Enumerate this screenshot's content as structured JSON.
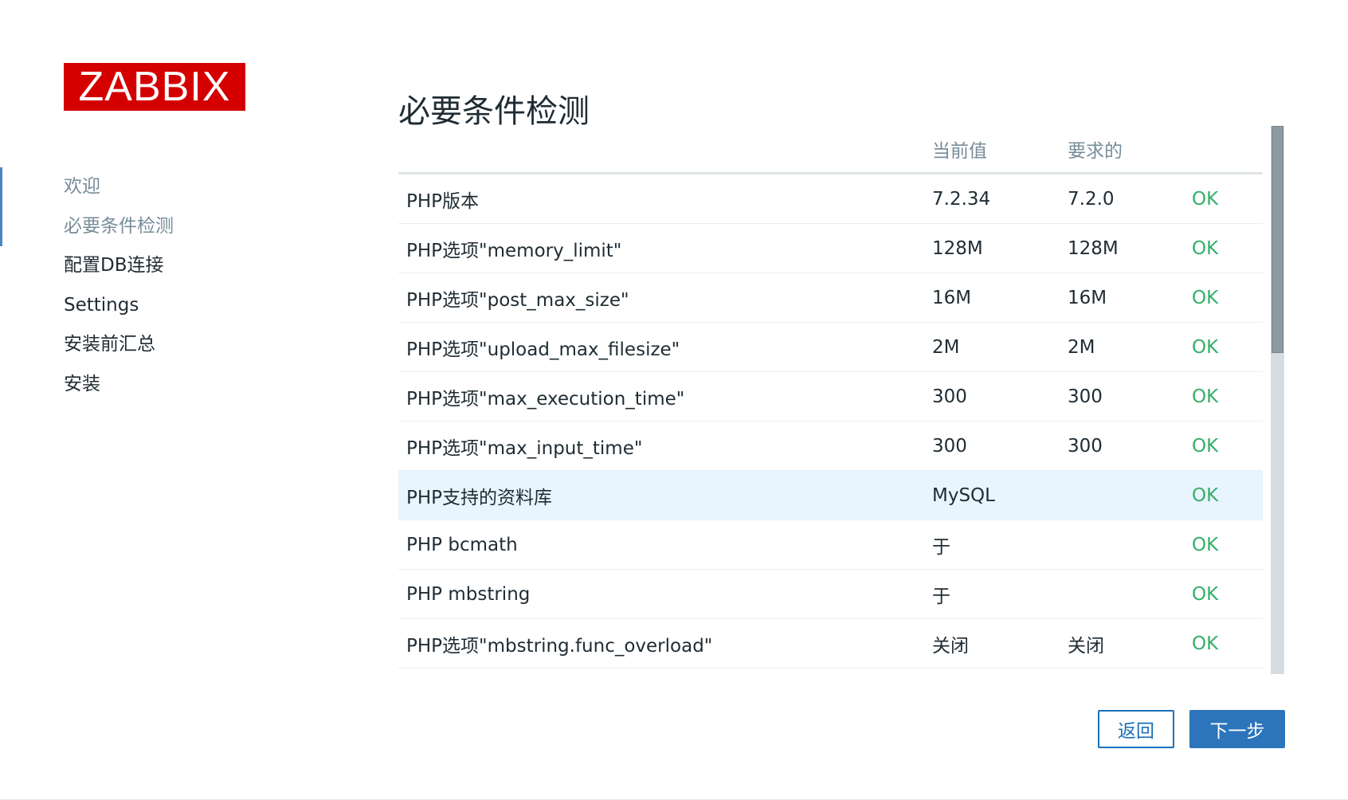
{
  "logo": {
    "text": "ZABBIX"
  },
  "sidebar": {
    "items": [
      {
        "label": "欢迎",
        "state": "done"
      },
      {
        "label": "必要条件检测",
        "state": "done"
      },
      {
        "label": "配置DB连接",
        "state": "pending"
      },
      {
        "label": "Settings",
        "state": "pending"
      },
      {
        "label": "安装前汇总",
        "state": "pending"
      },
      {
        "label": "安装",
        "state": "pending"
      }
    ]
  },
  "main": {
    "title": "必要条件检测",
    "table": {
      "headers": {
        "name": "",
        "current": "当前值",
        "required": "要求的",
        "status": ""
      },
      "rows": [
        {
          "name": "PHP版本",
          "current": "7.2.34",
          "required": "7.2.0",
          "status": "OK"
        },
        {
          "name": "PHP选项\"memory_limit\"",
          "current": "128M",
          "required": "128M",
          "status": "OK"
        },
        {
          "name": "PHP选项\"post_max_size\"",
          "current": "16M",
          "required": "16M",
          "status": "OK"
        },
        {
          "name": "PHP选项\"upload_max_filesize\"",
          "current": "2M",
          "required": "2M",
          "status": "OK"
        },
        {
          "name": "PHP选项\"max_execution_time\"",
          "current": "300",
          "required": "300",
          "status": "OK"
        },
        {
          "name": "PHP选项\"max_input_time\"",
          "current": "300",
          "required": "300",
          "status": "OK"
        },
        {
          "name": "PHP支持的资料库",
          "current": "MySQL",
          "required": "",
          "status": "OK",
          "highlight": true
        },
        {
          "name": "PHP bcmath",
          "current": "于",
          "required": "",
          "status": "OK"
        },
        {
          "name": "PHP mbstring",
          "current": "于",
          "required": "",
          "status": "OK"
        },
        {
          "name": "PHP选项\"mbstring.func_overload\"",
          "current": "关闭",
          "required": "关闭",
          "status": "OK"
        }
      ]
    }
  },
  "buttons": {
    "back": "返回",
    "next": "下一步"
  },
  "colors": {
    "brand": "#d40000",
    "ok": "#34af67",
    "primary": "#2c74bb",
    "muted": "#768d99",
    "highlight_row": "#e8f5ff"
  }
}
